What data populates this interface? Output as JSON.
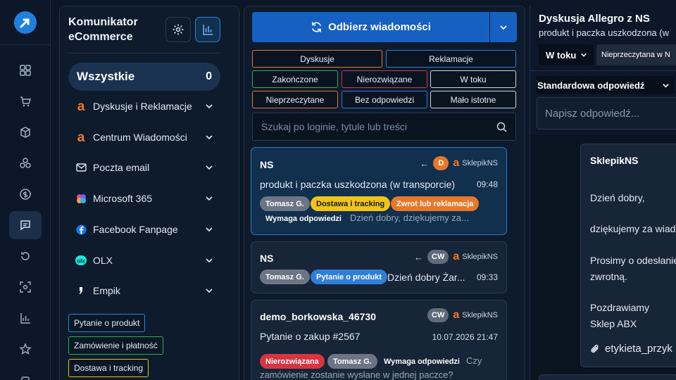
{
  "brand": {
    "line1": "Komunikator",
    "line2": "eCommerce"
  },
  "all_filter": {
    "label": "Wszystkie",
    "count": "0"
  },
  "sources": [
    {
      "label": "Dyskusje i Reklamacje",
      "icon": "allegro-icon"
    },
    {
      "label": "Centrum Wiadomości",
      "icon": "allegro-icon"
    },
    {
      "label": "Poczta email",
      "icon": "mail-icon"
    },
    {
      "label": "Microsoft 365",
      "icon": "microsoft365-icon"
    },
    {
      "label": "Facebook Fanpage",
      "icon": "facebook-icon"
    },
    {
      "label": "OLX",
      "icon": "olx-icon"
    },
    {
      "label": "Empik",
      "icon": "empik-icon"
    }
  ],
  "tags": [
    {
      "label": "Pytanie o produkt",
      "color": "#2f7fd9"
    },
    {
      "label": "Zamówienie i płatność",
      "color": "#2fae4e"
    },
    {
      "label": "Dostawa i tracking",
      "color": "#e9c22b"
    }
  ],
  "fetch_button": {
    "label": "Odbierz wiadomości"
  },
  "filters": {
    "row1": [
      {
        "label": "Dyskusje",
        "color": "#e7772a"
      },
      {
        "label": "Reklamacje",
        "color": "#2f7fd9"
      }
    ],
    "row2": [
      {
        "label": "Zakończone",
        "color": "#2fae4e"
      },
      {
        "label": "Nierozwiązane",
        "color": "#d9343f"
      },
      {
        "label": "W toku",
        "color": "#cfd6e0"
      }
    ],
    "row3": [
      {
        "label": "Nieprzeczytane",
        "color": "#e7772a"
      },
      {
        "label": "Bez odpowiedzi",
        "color": "#2f7fd9"
      },
      {
        "label": "Mało istotne",
        "color": "#cfd6e0"
      }
    ]
  },
  "search": {
    "placeholder": "Szukaj po loginie, tytule lub treści"
  },
  "conversations": [
    {
      "name": "NS",
      "badge": "D",
      "shop": "SklepikNS",
      "subject": "produkt i paczka uszkodzona (w transporcie)",
      "time": "09:48",
      "pills": [
        "Tomasz G.",
        "Dostawa i tracking",
        "Zwrot lub reklamacja"
      ],
      "pill2": "Wymaga odpowiedzi",
      "preview": "Dzień dobry, dziękujemy za..."
    },
    {
      "name": "NS",
      "badge": "CW",
      "shop": "SklepikNS",
      "pills": [
        "Tomasz G.",
        "Pytanie o produkt"
      ],
      "preview": "Dzień dobry Żar...",
      "time": "09:33"
    },
    {
      "name": "demo_borkowska_46730",
      "badge": "CW",
      "shop": "SklepikNS",
      "subject": "Pytanie o zakup #2567",
      "time": "10.07.2026 21:47",
      "pills": [
        "Nierozwiązana",
        "Tomasz G.",
        "Wymaga odpowiedzi"
      ],
      "preview_a": "Czy",
      "preview_b": "zamówienie zostanie wysłane w jednej paczce?"
    }
  ],
  "detail": {
    "title": "Dyskusja Allegro z NS",
    "subtitle": "produkt i paczka uszkodzona (w",
    "status": "W toku",
    "read_status": "Nieprzeczytana w N",
    "template": "Standardowa odpowiedź",
    "reply_placeholder": "Napisz odpowiedź...",
    "message": {
      "from": "SklepikNS",
      "lines": [
        "Dzień dobry,",
        "dziękujemy za wiado",
        "Prosimy o odesłanie",
        "zwrotną.",
        "Pozdrawiamy",
        "Sklep ABX"
      ],
      "attachment": "etykieta_przyk"
    }
  }
}
